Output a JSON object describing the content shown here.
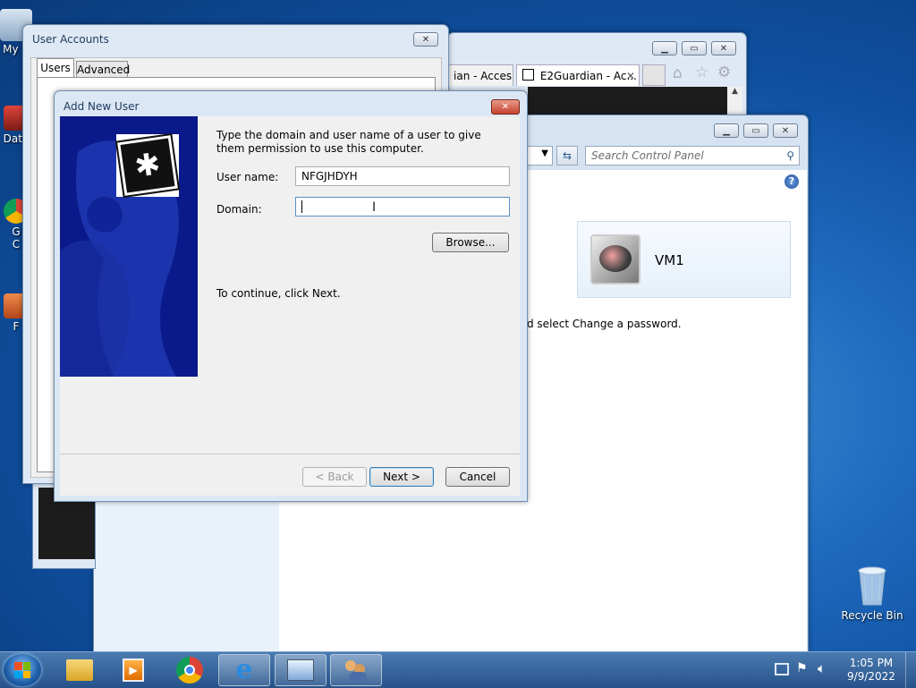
{
  "desktop": {
    "icons": [
      {
        "label": "My C",
        "name": "my-computer"
      },
      {
        "label": "Data",
        "name": "data-shortcut"
      },
      {
        "label": "G\nC",
        "name": "google-chrome-shortcut"
      },
      {
        "label": "F",
        "name": "f-shortcut"
      },
      {
        "label": "Recycle Bin",
        "name": "recycle-bin"
      }
    ]
  },
  "user_accounts": {
    "title": "User Accounts",
    "tabs": [
      "Users",
      "Advanced"
    ]
  },
  "browser": {
    "tabs": [
      "ian - Acces...",
      "E2Guardian - Ac..."
    ]
  },
  "control_panel": {
    "search_placeholder": "Search Control Panel",
    "account_name": "VM1",
    "instruction_tail": "d select Change a password."
  },
  "dialog": {
    "title": "Add New User",
    "instruction": "Type the domain and user name of a user to give them permission to use this computer.",
    "username_label": "User name:",
    "username_value": "NFGJHDYH",
    "domain_label": "Domain:",
    "domain_value": "",
    "browse_label": "Browse...",
    "continue_text": "To continue, click Next.",
    "back_label": "< Back",
    "next_label": "Next >",
    "cancel_label": "Cancel"
  },
  "taskbar": {
    "time": "1:05 PM",
    "date": "9/9/2022"
  },
  "colors": {
    "dialog_banner": "#0a1a8a",
    "close_red": "#c7422c"
  }
}
